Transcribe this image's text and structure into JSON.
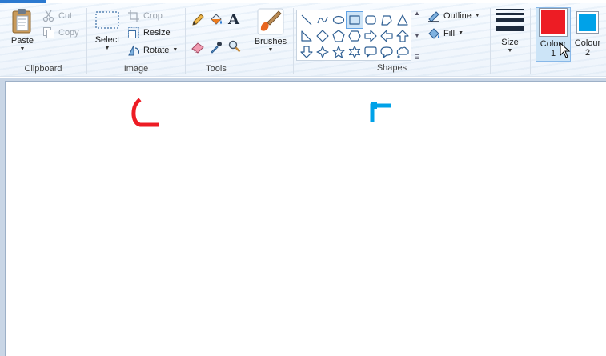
{
  "ribbon": {
    "clipboard": {
      "paste_label": "Paste",
      "cut_label": "Cut",
      "copy_label": "Copy",
      "group_label": "Clipboard"
    },
    "image": {
      "select_label": "Select",
      "crop_label": "Crop",
      "resize_label": "Resize",
      "rotate_label": "Rotate",
      "group_label": "Image"
    },
    "tools": {
      "group_label": "Tools",
      "text_tool_glyph": "A"
    },
    "brushes": {
      "label": "Brushes"
    },
    "shapes": {
      "group_label": "Shapes",
      "outline_label": "Outline",
      "fill_label": "Fill",
      "items": [
        "line-icon",
        "curve-icon",
        "oval-icon",
        "rectangle-icon",
        "rounded-rectangle-icon",
        "polygon-icon",
        "triangle-icon",
        "right-triangle-icon",
        "diamond-icon",
        "pentagon-icon",
        "hexagon-icon",
        "right-arrow-icon",
        "left-arrow-icon",
        "up-arrow-icon",
        "down-arrow-icon",
        "four-point-star-icon",
        "five-point-star-icon",
        "six-point-star-icon",
        "rounded-callout-icon",
        "oval-callout-icon",
        "cloud-callout-icon"
      ],
      "selected": "rectangle-icon"
    },
    "size": {
      "label": "Size"
    },
    "colours": {
      "colour1_label_line1": "Colour",
      "colour1_label_line2": "1",
      "colour1_value": "#ed1c24",
      "colour2_label_line1": "Colour",
      "colour2_label_line2": "2",
      "colour2_value": "#00a2e8"
    }
  },
  "canvas": {
    "background": "#ffffff",
    "strokes": [
      {
        "colour": "#ed1c24",
        "shape": "red-corner-stroke"
      },
      {
        "colour": "#00a2e8",
        "shape": "blue-corner-stroke"
      }
    ]
  }
}
